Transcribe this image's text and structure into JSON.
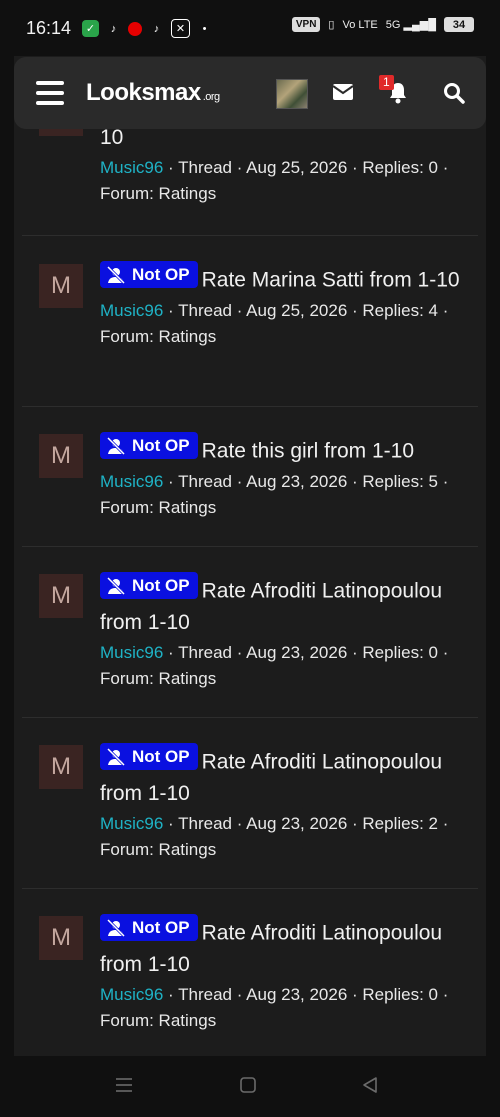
{
  "status_bar": {
    "time": "16:14",
    "vpn": "VPN",
    "network_type": "Vo LTE",
    "signal": "5G",
    "battery": "34"
  },
  "header": {
    "logo": "Looksmax",
    "logo_suffix": ".org",
    "notification_count": "1",
    "icons": [
      "menu-icon",
      "thumbnail",
      "mail-icon",
      "bell-icon",
      "search-icon"
    ]
  },
  "threads": [
    {
      "avatar": "M",
      "badge": "",
      "title": "10",
      "user": "Music96",
      "meta": " · Thread · Aug 25, 2026 · Replies: 0 · Forum: Ratings"
    },
    {
      "avatar": "M",
      "badge": "Not OP",
      "title": "Rate Marina Satti from 1-10",
      "user": "Music96",
      "meta": " · Thread · Aug 25, 2026 · Replies: 4 · Forum: Ratings"
    },
    {
      "avatar": "M",
      "badge": "Not OP",
      "title": "Rate this girl from 1-10",
      "user": "Music96",
      "meta": " · Thread · Aug 23, 2026 · Replies: 5 · Forum: Ratings"
    },
    {
      "avatar": "M",
      "badge": "Not OP",
      "title": "Rate Afroditi Latinopoulou from 1-10",
      "user": "Music96",
      "meta": " · Thread · Aug 23, 2026 · Replies: 0 · Forum: Ratings"
    },
    {
      "avatar": "M",
      "badge": "Not OP",
      "title": "Rate Afroditi Latinopoulou from 1-10",
      "user": "Music96",
      "meta": " · Thread · Aug 23, 2026 · Replies: 2 · Forum: Ratings"
    },
    {
      "avatar": "M",
      "badge": "Not OP",
      "title": "Rate Afroditi Latinopoulou from 1-10",
      "user": "Music96",
      "meta": " · Thread · Aug 23, 2026 · Replies: 0 · Forum: Ratings"
    }
  ],
  "colors": {
    "badge": "#0a10e0",
    "username": "#1fb3c6",
    "avatar_bg": "#3a2422",
    "notification": "#e02a2a"
  }
}
